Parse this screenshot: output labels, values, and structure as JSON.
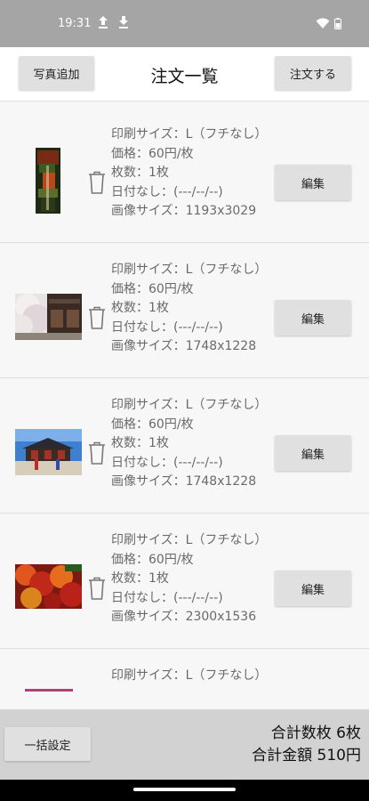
{
  "status_bar": {
    "time": "19:31",
    "icons": [
      "upload-icon",
      "download-icon",
      "wifi-icon",
      "battery-icon"
    ]
  },
  "header": {
    "add_photo_label": "写真追加",
    "title": "注文一覧",
    "order_label": "注文する"
  },
  "items": [
    {
      "print_size": "印刷サイズ：L（フチなし）",
      "price": "価格：60円/枚",
      "count": "枚数：1枚",
      "date": "日付なし：(---/--/--)",
      "image_size": "画像サイズ：1193x3029",
      "edit_label": "編集",
      "thumbnail": "autumn-temple-vertical"
    },
    {
      "print_size": "印刷サイズ：L（フチなし）",
      "price": "価格：60円/枚",
      "count": "枚数：1枚",
      "date": "日付なし：(---/--/--)",
      "image_size": "画像サイズ：1748x1228",
      "edit_label": "編集",
      "thumbnail": "cherry-blossom-house"
    },
    {
      "print_size": "印刷サイズ：L（フチなし）",
      "price": "価格：60円/枚",
      "count": "枚数：1枚",
      "date": "日付なし：(---/--/--)",
      "image_size": "画像サイズ：1748x1228",
      "edit_label": "編集",
      "thumbnail": "palace-gate"
    },
    {
      "print_size": "印刷サイズ：L（フチなし）",
      "price": "価格：60円/枚",
      "count": "枚数：1枚",
      "date": "日付なし：(---/--/--)",
      "image_size": "画像サイズ：2300x1536",
      "edit_label": "編集",
      "thumbnail": "red-maple-leaves"
    },
    {
      "print_size": "印刷サイズ：L（フチなし）",
      "thumbnail": "pink-strip"
    }
  ],
  "footer": {
    "bulk_label": "一括設定",
    "total_count": "合計数枚 6枚",
    "total_price": "合計金額 510円"
  },
  "colors": {
    "status_bar": "#a5a5a5",
    "button": "#e0e0e0",
    "footer": "#d2d2d2",
    "info_text": "#6a6a6a"
  }
}
